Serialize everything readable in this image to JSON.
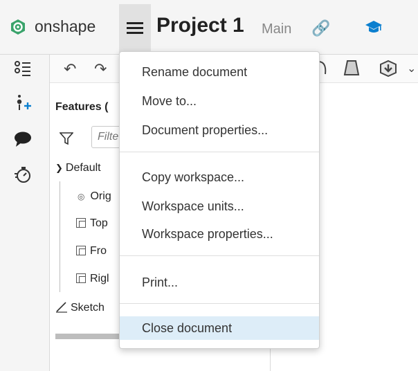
{
  "header": {
    "brand": "onshape",
    "title": "Project 1",
    "branch": "Main",
    "icons": [
      "onshape-logo-icon",
      "menu-icon",
      "link-icon",
      "learning-center-icon"
    ]
  },
  "rail": {
    "icons": [
      "feature-list-icon",
      "insertable-icon",
      "comments-icon",
      "timer-icon"
    ]
  },
  "toolbar": {
    "icons": [
      "undo-icon",
      "redo-icon",
      "revolve-icon",
      "loft-icon",
      "insert-part-icon",
      "chevron-down-icon"
    ]
  },
  "features": {
    "title": "Features (",
    "filter_placeholder": "Filte",
    "tree": [
      {
        "label": "Default",
        "type": "group"
      },
      {
        "label": "Orig",
        "type": "origin"
      },
      {
        "label": "Top",
        "type": "plane"
      },
      {
        "label": "Fro",
        "type": "plane"
      },
      {
        "label": "Rigl",
        "type": "plane"
      },
      {
        "label": "Sketch",
        "type": "sketch"
      }
    ]
  },
  "menu": {
    "groups": [
      [
        "Rename document",
        "Move to...",
        "Document properties..."
      ],
      [
        "Copy workspace...",
        "Workspace units...",
        "Workspace properties..."
      ],
      [
        "Print..."
      ],
      [
        "Close document"
      ]
    ],
    "highlighted": "Close document",
    "highlight_color": "#ddedf8"
  },
  "colors": {
    "accent": "#0b7fcf",
    "brand_green": "#3aa36b"
  }
}
